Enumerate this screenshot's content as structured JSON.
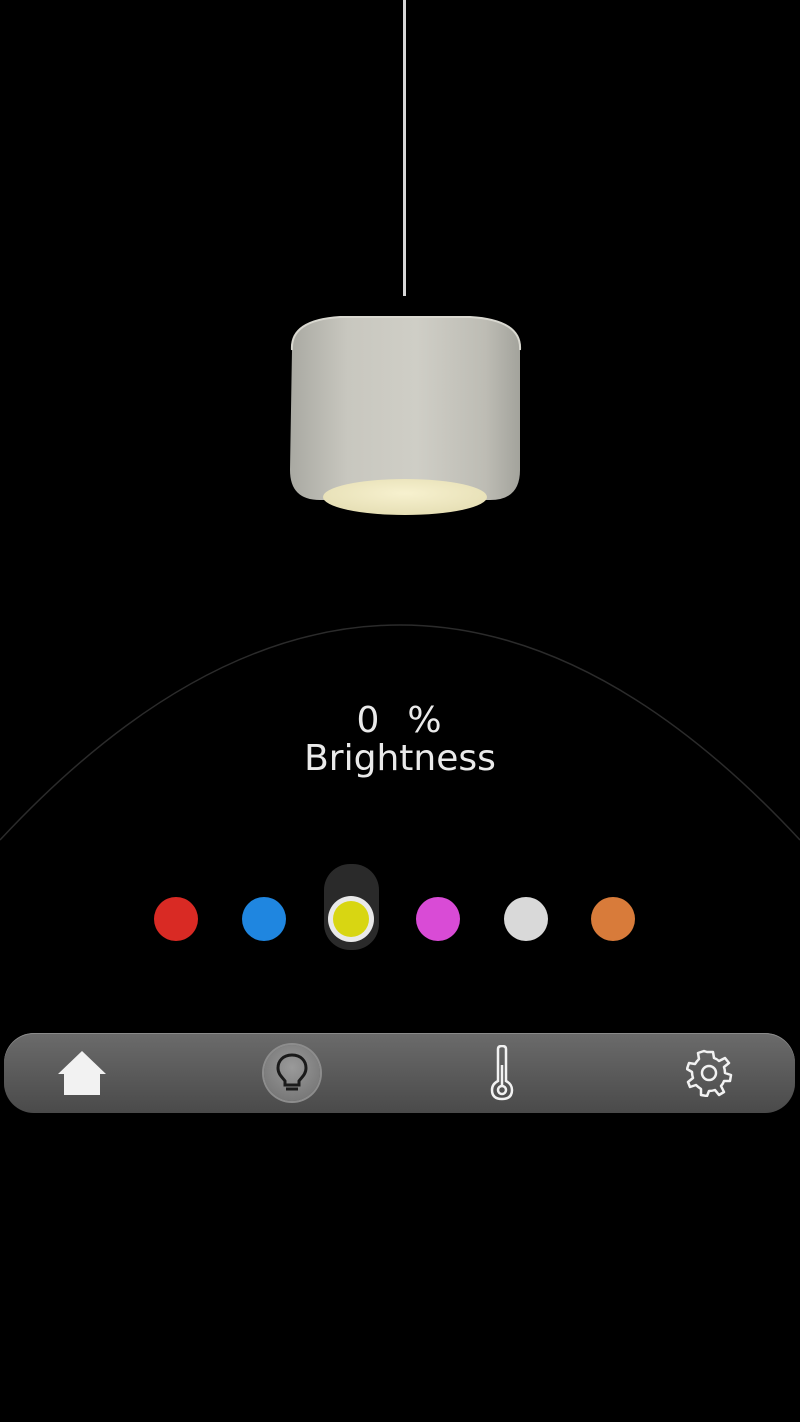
{
  "brightness": {
    "value": "0",
    "unit": "%",
    "label": "Brightness"
  },
  "colors": {
    "swatches": [
      {
        "name": "red",
        "hex": "#d92a24"
      },
      {
        "name": "blue",
        "hex": "#1f86e0"
      },
      {
        "name": "yellow",
        "hex": "#d8d612",
        "selected": true
      },
      {
        "name": "magenta",
        "hex": "#d94bd6"
      },
      {
        "name": "white",
        "hex": "#d9d9d9"
      },
      {
        "name": "orange",
        "hex": "#d87b3a"
      }
    ]
  },
  "nav": {
    "items": [
      {
        "id": "home",
        "icon": "home-icon"
      },
      {
        "id": "light",
        "icon": "lightbulb-icon",
        "active": true
      },
      {
        "id": "temperature",
        "icon": "thermometer-icon"
      },
      {
        "id": "settings",
        "icon": "gear-icon"
      }
    ]
  }
}
